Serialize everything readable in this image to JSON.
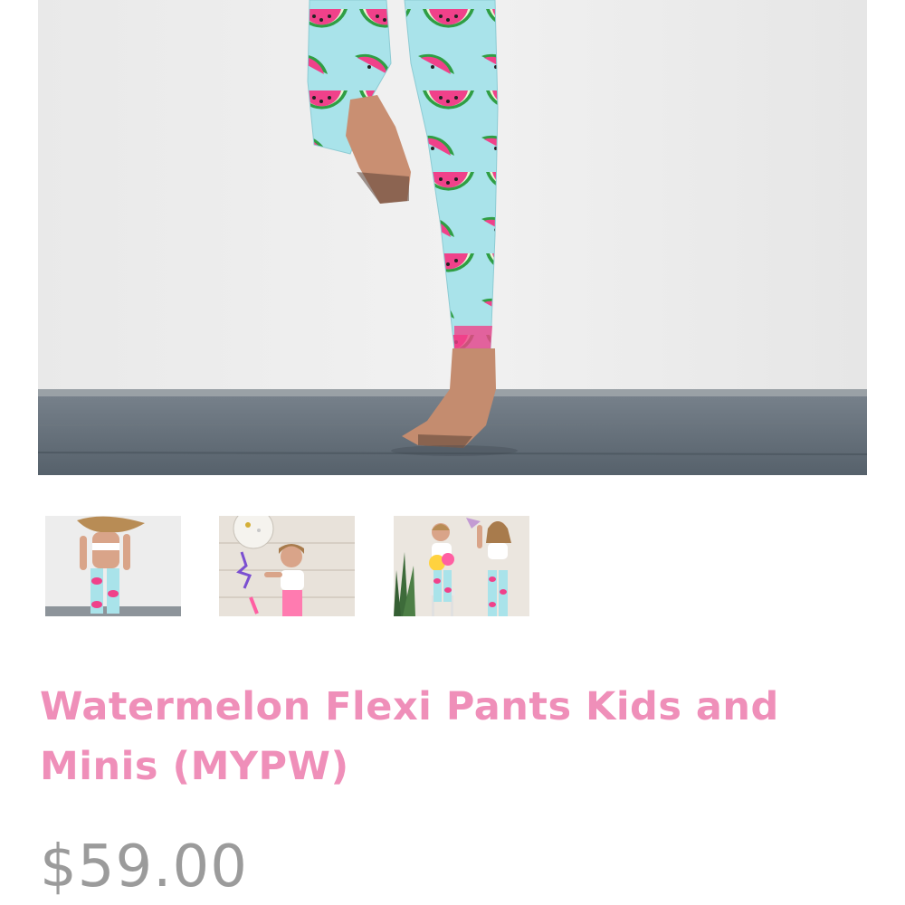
{
  "product": {
    "title": "Watermelon Flexi Pants Kids and Minis (MYPW)",
    "price": "$59.00"
  },
  "gallery": {
    "main_image": "watermelon-leggings-running-photo",
    "thumbnails": [
      "girl-dancing-back-view-photo",
      "girl-with-balloon-photo",
      "two-girls-with-props-photo"
    ]
  },
  "colors": {
    "title": "#ef8fb9",
    "price": "#9b9b9b",
    "legging_base": "#a9e3ea",
    "melon_pink": "#f0418a",
    "rind_green": "#2f9e44",
    "wall": "#ebebeb",
    "floor": "#5f6a72"
  }
}
